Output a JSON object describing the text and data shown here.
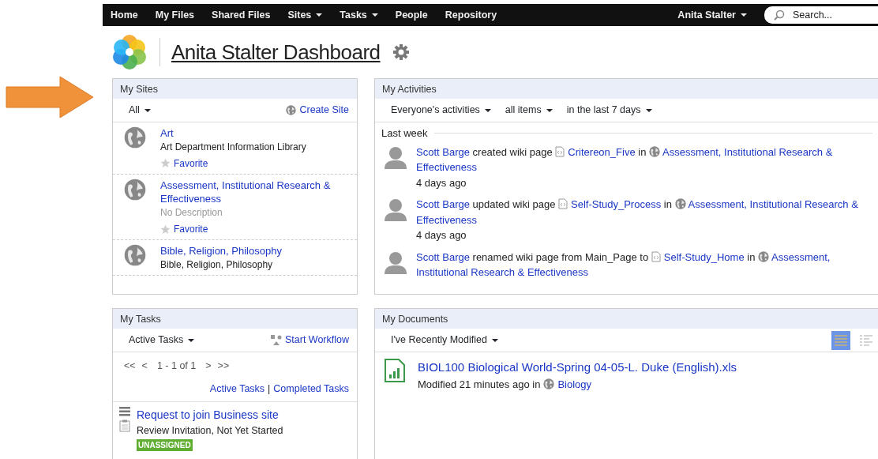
{
  "nav": {
    "items": [
      {
        "label": "Home",
        "dropdown": false
      },
      {
        "label": "My Files",
        "dropdown": false
      },
      {
        "label": "Shared Files",
        "dropdown": false
      },
      {
        "label": "Sites",
        "dropdown": true
      },
      {
        "label": "Tasks",
        "dropdown": true
      },
      {
        "label": "People",
        "dropdown": false
      },
      {
        "label": "Repository",
        "dropdown": false
      }
    ],
    "user": {
      "label": "Anita Stalter",
      "dropdown": true
    },
    "search": {
      "placeholder": "Search..."
    }
  },
  "header": {
    "title": "Anita Stalter Dashboard"
  },
  "my_sites": {
    "title": "My Sites",
    "filter": "All",
    "action": "Create Site",
    "sites": [
      {
        "name": "Art",
        "description": "Art Department Information Library",
        "muted": false,
        "favorite": "Favorite"
      },
      {
        "name": "Assessment, Institutional Research & Effectiveness",
        "description": "No Description",
        "muted": true,
        "favorite": "Favorite"
      },
      {
        "name": "Bible, Religion, Philosophy",
        "description": "Bible, Religion, Philosophy",
        "muted": false
      }
    ]
  },
  "my_activities": {
    "title": "My Activities",
    "filters": [
      "Everyone's activities",
      "all items",
      "in the last 7 days"
    ],
    "group": "Last week",
    "items": [
      {
        "segments": [
          {
            "kind": "user",
            "text": "Scott Barge"
          },
          {
            "kind": "text",
            "text": "created wiki page"
          },
          {
            "kind": "page",
            "text": "Critereon_Five"
          },
          {
            "kind": "text",
            "text": "in"
          },
          {
            "kind": "site",
            "text": "Assessment, Institutional Research & Effectiveness"
          }
        ],
        "time": "4 days ago"
      },
      {
        "segments": [
          {
            "kind": "user",
            "text": "Scott Barge"
          },
          {
            "kind": "text",
            "text": "updated wiki page"
          },
          {
            "kind": "page",
            "text": "Self-Study_Process"
          },
          {
            "kind": "text",
            "text": "in"
          },
          {
            "kind": "site",
            "text": "Assessment, Institutional Research & Effectiveness"
          }
        ],
        "time": "4 days ago"
      },
      {
        "segments": [
          {
            "kind": "user",
            "text": "Scott Barge"
          },
          {
            "kind": "text",
            "text": "renamed wiki page from Main_Page to"
          },
          {
            "kind": "page",
            "text": "Self-Study_Home"
          },
          {
            "kind": "text",
            "text": "in"
          },
          {
            "kind": "site",
            "text": "Assessment, Institutional Research & Effectiveness"
          }
        ]
      }
    ]
  },
  "my_tasks": {
    "title": "My Tasks",
    "filter": "Active Tasks",
    "action": "Start Workflow",
    "pager": {
      "first": "<<",
      "prev": "<",
      "info": "1 - 1 of 1",
      "next": ">",
      "last": ">>"
    },
    "links": [
      "Active Tasks",
      "Completed Tasks"
    ],
    "separator": "|",
    "items": [
      {
        "title": "Request to join Business site",
        "status": "Review Invitation, Not Yet Started",
        "badge": "UNASSIGNED"
      }
    ]
  },
  "my_documents": {
    "title": "My Documents",
    "filter": "I've Recently Modified",
    "views": [
      {
        "kind": "detailed",
        "selected": true
      },
      {
        "kind": "simple",
        "selected": false
      }
    ],
    "items": [
      {
        "name": "BIOL100 Biological World-Spring 04-05-L. Duke (English).xls",
        "modified": "Modified 21 minutes ago in",
        "site": "Biology"
      }
    ]
  }
}
